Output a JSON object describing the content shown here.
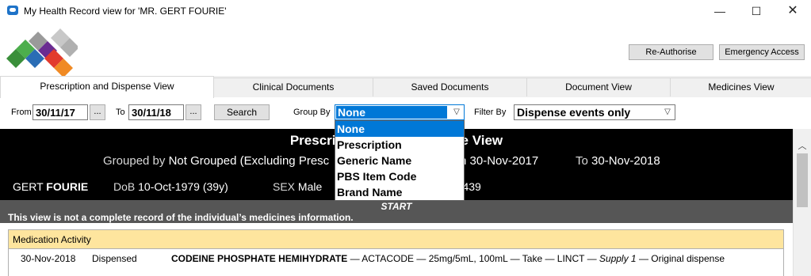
{
  "window": {
    "title": "My Health Record view for 'MR. GERT FOURIE'",
    "minimize": "—",
    "maximize": "☐",
    "close": "✕"
  },
  "header": {
    "reauthorise_label": "Re-Authorise",
    "emergency_label": "Emergency Access"
  },
  "tabs": [
    {
      "label": "Prescription and Dispense View",
      "active": true
    },
    {
      "label": "Clinical Documents"
    },
    {
      "label": "Saved Documents"
    },
    {
      "label": "Document View"
    },
    {
      "label": "Medicines View"
    }
  ],
  "filters": {
    "from_label": "From",
    "from_value": "30/11/17",
    "to_label": "To",
    "to_value": "30/11/18",
    "ellipsis": "...",
    "search_label": "Search",
    "group_label": "Group By",
    "group_value": "None",
    "group_options": [
      "None",
      "Prescription",
      "Generic Name",
      "PBS Item Code",
      "Brand Name"
    ],
    "filter_label": "Filter By",
    "filter_value": "Dispense events only"
  },
  "report": {
    "title_left": "Prescri",
    "title_right": "e View",
    "grouped_prefix": "Grouped by ",
    "grouped_value": "Not Grouped (Excluding Presc",
    "from_date_tail": "n 30-Nov-2017",
    "to_prefix": "To ",
    "to_value": "30-Nov-2018",
    "patient_first": "GERT ",
    "patient_last": "FOURIE",
    "dob_label": "DoB ",
    "dob_value": "10-Oct-1979 (39y)",
    "sex_label": "SEX ",
    "sex_value": "Male",
    "ihi_tail": "5 5439",
    "start_label": "START",
    "disclaimer": "This view is not a complete record of the individual’s medicines information."
  },
  "medication": {
    "header": "Medication Activity",
    "rows": [
      {
        "date": "30-Nov-2018",
        "event": "Dispensed",
        "drug": "CODEINE PHOSPHATE HEMIHYDRATE",
        "details": " — ACTACODE — 25mg/5mL, 100mL — Take — LINCT — ",
        "supply": "Supply 1",
        "tail": " — Original dispense"
      }
    ]
  },
  "colors": {
    "selection": "#0078d7",
    "banner": "#000000",
    "strip": "#565656",
    "table_header": "#fee59e"
  },
  "icons": {
    "app": "health-record-icon",
    "logo": "mhr-logo-icon",
    "dropdown": "chevron-down-icon",
    "scroll_up": "chevron-up-icon"
  }
}
